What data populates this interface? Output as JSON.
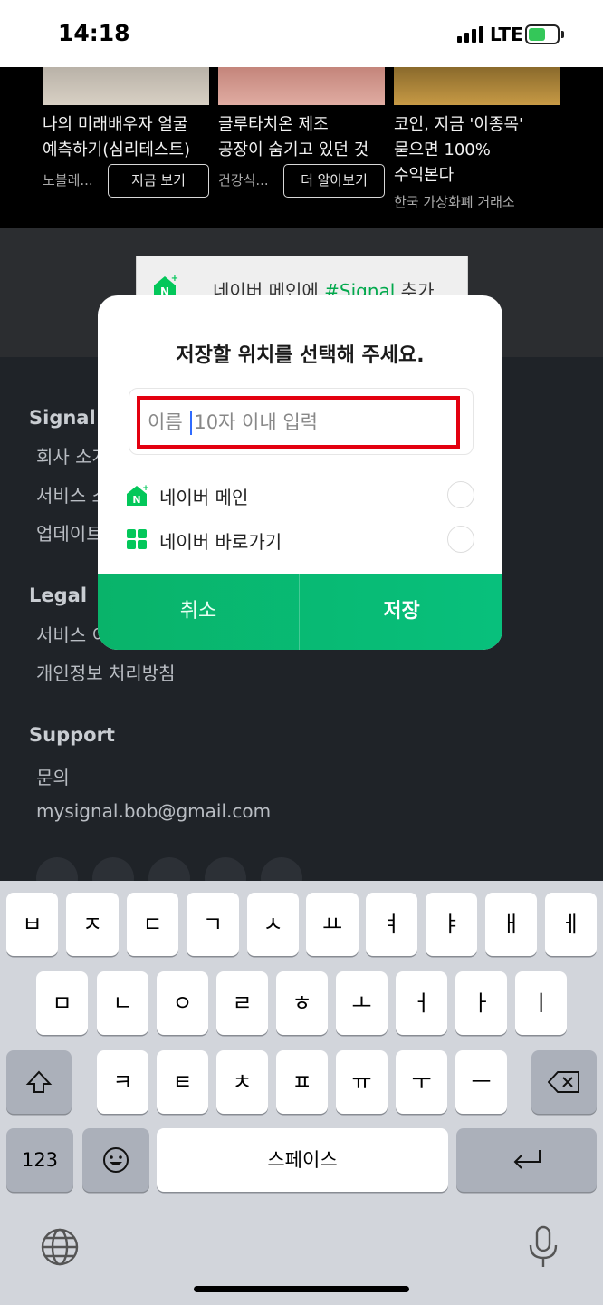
{
  "status_bar": {
    "time": "14:18",
    "network": "LTE"
  },
  "ads": [
    {
      "title": "나의 미래배우자 얼굴\n예측하기(심리테스트)",
      "source": "노블레...",
      "cta": "지금 보기"
    },
    {
      "title": "글루타치온 제조\n공장이 숨기고 있던 것",
      "source": "건강식...",
      "cta": "더 알아보기"
    },
    {
      "title": "코인, 지금 '이종목'\n묻으면 100%\n수익본다",
      "source": "한국 가상화폐 거래소"
    }
  ],
  "banner": {
    "text_before": "네이버 메인에 ",
    "highlight": "#Signal",
    "text_after": " 추가"
  },
  "footer": {
    "signal": {
      "title": "Signal",
      "links": [
        "회사 소개",
        "서비스 소개",
        "업데이트"
      ]
    },
    "legal": {
      "title": "Legal",
      "links": [
        "서비스 이용약관",
        "개인정보 처리방침"
      ]
    },
    "support": {
      "title": "Support",
      "links": [
        "문의",
        "mysignal.bob@gmail.com"
      ]
    }
  },
  "dialog": {
    "title": "저장할 위치를 선택해 주세요.",
    "input_placeholder_before": "이름",
    "input_placeholder_after": "10자 이내 입력",
    "options": [
      {
        "label": "네이버 메인",
        "icon": "naver-main-icon"
      },
      {
        "label": "네이버 바로가기",
        "icon": "naver-shortcut-icon"
      }
    ],
    "cancel_label": "취소",
    "save_label": "저장"
  },
  "keyboard": {
    "row1": [
      "ㅂ",
      "ㅈ",
      "ㄷ",
      "ㄱ",
      "ㅅ",
      "ㅛ",
      "ㅕ",
      "ㅑ",
      "ㅐ",
      "ㅔ"
    ],
    "row2": [
      "ㅁ",
      "ㄴ",
      "ㅇ",
      "ㄹ",
      "ㅎ",
      "ㅗ",
      "ㅓ",
      "ㅏ",
      "ㅣ"
    ],
    "row3": [
      "ㅋ",
      "ㅌ",
      "ㅊ",
      "ㅍ",
      "ㅠ",
      "ㅜ",
      "ㅡ"
    ],
    "numbers_label": "123",
    "space_label": "스페이스"
  },
  "colors": {
    "accent_green": "#09b36a",
    "highlight_red": "#e3000f",
    "dark_bg": "#1f2328"
  }
}
